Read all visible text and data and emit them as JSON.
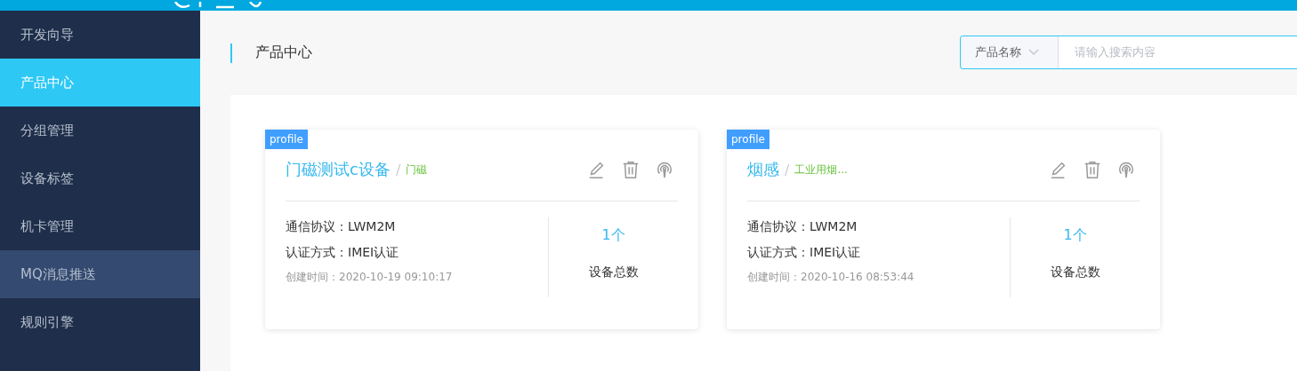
{
  "sidebar": {
    "items": [
      {
        "label": "开发向导",
        "selected": false,
        "highlighted": false
      },
      {
        "label": "产品中心",
        "selected": true,
        "highlighted": false
      },
      {
        "label": "分组管理",
        "selected": false,
        "highlighted": false
      },
      {
        "label": "设备标签",
        "selected": false,
        "highlighted": false
      },
      {
        "label": "机卡管理",
        "selected": false,
        "highlighted": false
      },
      {
        "label": "MQ消息推送",
        "selected": false,
        "highlighted": true
      },
      {
        "label": "规则引擎",
        "selected": false,
        "highlighted": false
      }
    ]
  },
  "page_title": "产品中心",
  "search": {
    "filter": "产品名称",
    "placeholder": "请输入搜索内容"
  },
  "products": [
    {
      "badge": "profile",
      "name": "门磁测试c设备",
      "separator": "/",
      "category": "门磁",
      "protocol": "通信协议：LWM2M",
      "auth": "认证方式：IMEI认证",
      "created": "创建时间：2020-10-19 09:10:17",
      "count": "1个",
      "count_label": "设备总数"
    },
    {
      "badge": "profile",
      "name": "烟感",
      "separator": "/",
      "category": "工业用烟...",
      "protocol": "通信协议：LWM2M",
      "auth": "认证方式：IMEI认证",
      "created": "创建时间：2020-10-16 08:53:44",
      "count": "1个",
      "count_label": "设备总数"
    }
  ]
}
